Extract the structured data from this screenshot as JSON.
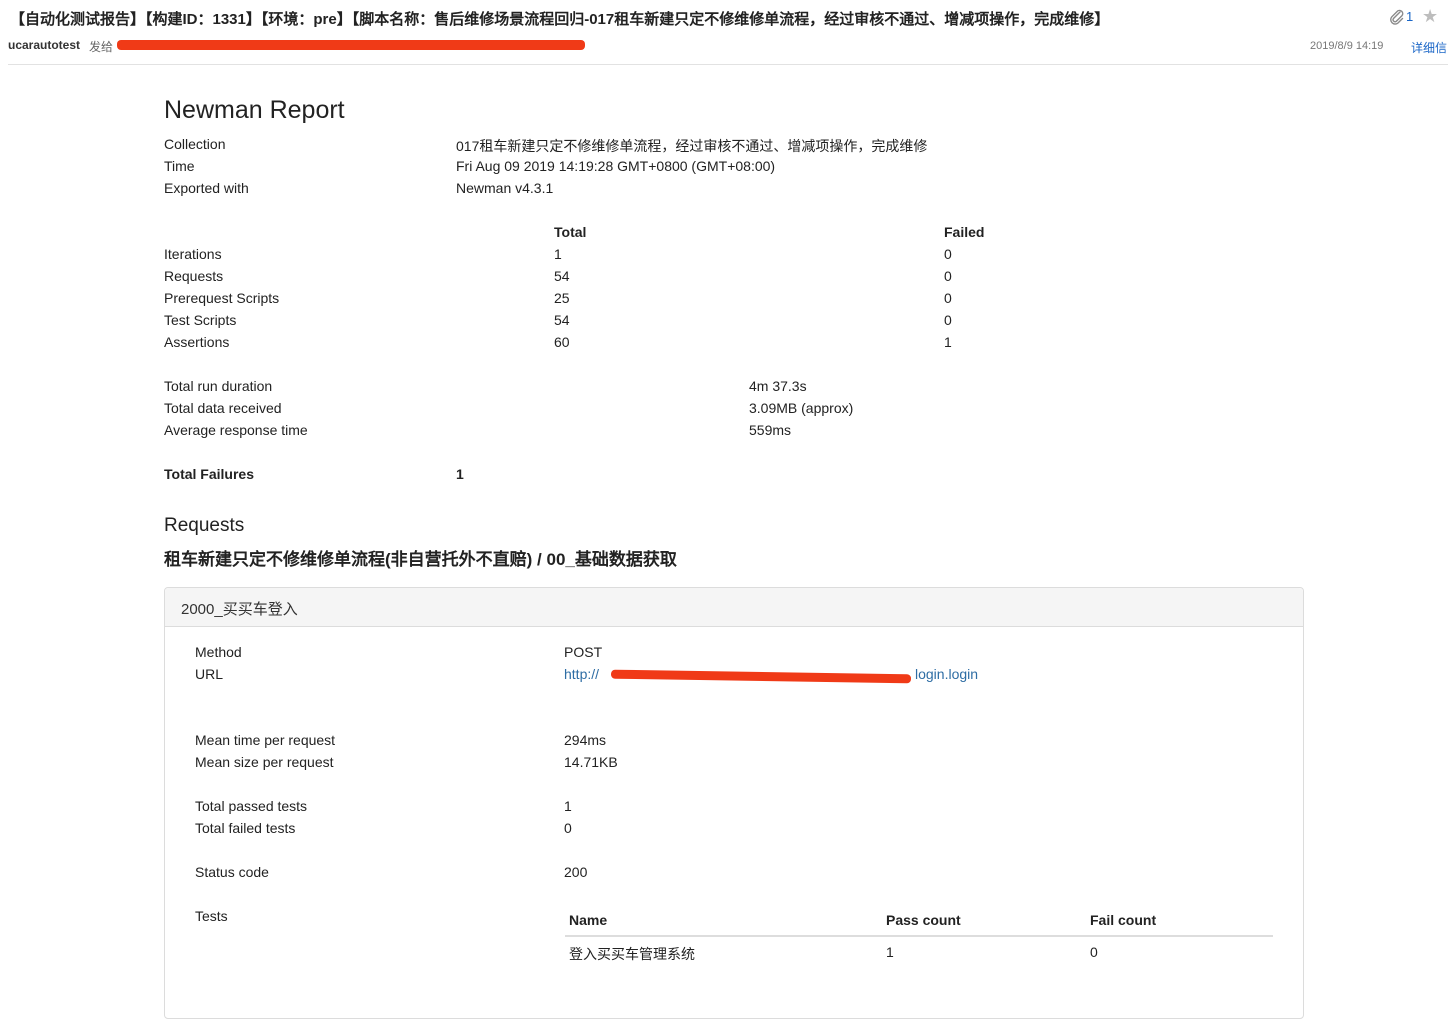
{
  "mail": {
    "subject": "【自动化测试报告】【构建ID：1331】【环境：pre】【脚本名称：售后维修场景流程回归-017租车新建只定不修维修单流程，经过审核不通过、增减项操作，完成维修】",
    "sender": "ucarautotest",
    "to_label": "发给",
    "date": "2019/8/9  14:19",
    "detail_link": "详细信",
    "attachment_count": "1",
    "icons": {
      "attachment": "paperclip-icon",
      "star": "star-icon"
    },
    "redaction_color": "#f03a17"
  },
  "report": {
    "title": "Newman Report",
    "meta": [
      {
        "label": "Collection",
        "value": "017租车新建只定不修维修单流程，经过审核不通过、增减项操作，完成维修"
      },
      {
        "label": "Time",
        "value": "Fri Aug 09 2019 14:19:28 GMT+0800 (GMT+08:00)"
      },
      {
        "label": "Exported with",
        "value": "Newman v4.3.1"
      }
    ],
    "summary": {
      "total_header": "Total",
      "failed_header": "Failed",
      "rows": [
        {
          "label": "Iterations",
          "total": "1",
          "failed": "0"
        },
        {
          "label": "Requests",
          "total": "54",
          "failed": "0"
        },
        {
          "label": "Prerequest Scripts",
          "total": "25",
          "failed": "0"
        },
        {
          "label": "Test Scripts",
          "total": "54",
          "failed": "0"
        },
        {
          "label": "Assertions",
          "total": "60",
          "failed": "1"
        }
      ]
    },
    "run": [
      {
        "label": "Total run duration",
        "value": "4m 37.3s"
      },
      {
        "label": "Total data received",
        "value": "3.09MB (approx)"
      },
      {
        "label": "Average response time",
        "value": "559ms"
      }
    ],
    "total_failures": {
      "label": "Total Failures",
      "value": "1"
    },
    "requests_heading": "Requests",
    "folder_title": "租车新建只定不修维修单流程(非自营托外不直赔) / 00_基础数据获取",
    "request": {
      "name": "2000_买买车登入",
      "method_label": "Method",
      "method": "POST",
      "url_label": "URL",
      "url_prefix": "http://",
      "url_suffix": "login.login",
      "mean_time_label": "Mean time per request",
      "mean_time": "294ms",
      "mean_size_label": "Mean size per request",
      "mean_size": "14.71KB",
      "passed_label": "Total passed tests",
      "passed": "1",
      "failed_label": "Total failed tests",
      "failed": "0",
      "status_label": "Status code",
      "status": "200",
      "tests_label": "Tests",
      "tests_table": {
        "headers": [
          "Name",
          "Pass count",
          "Fail count"
        ],
        "rows": [
          {
            "name": "登入买买车管理系统",
            "pass": "1",
            "fail": "0"
          }
        ]
      }
    }
  }
}
